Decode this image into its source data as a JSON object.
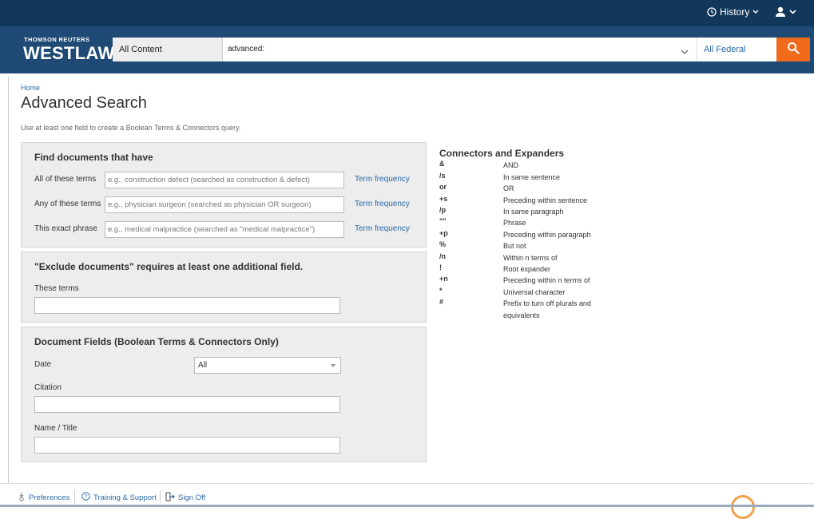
{
  "topbar": {
    "history_label": "History",
    "icons": [
      "clock-icon",
      "chevron-down-icon",
      "user-icon"
    ]
  },
  "header": {
    "brand_small": "THOMSON REUTERS",
    "brand_big": "WESTLAW",
    "content_select": "All Content",
    "search_value": "advanced:",
    "jurisdiction": "All Federal",
    "search_icon": "search-icon"
  },
  "breadcrumb": "Home",
  "page_title": "Advanced Search",
  "instructions": "Use at least one field to create a Boolean Terms & Connectors query.",
  "find_panel": {
    "title": "Find documents that have",
    "term_frequency": "Term frequency",
    "fields": [
      {
        "label": "All of these terms",
        "placeholder": "e.g., construction defect (searched as construction & defect)"
      },
      {
        "label": "Any of these terms",
        "placeholder": "e.g., physician surgeon (searched as physician OR surgeon)"
      },
      {
        "label": "This exact phrase",
        "placeholder": "e.g., medical malpractice (searched as \"medical malpractice\")"
      }
    ]
  },
  "exclude_panel": {
    "title": "\"Exclude documents\" requires at least one additional field.",
    "label": "These terms"
  },
  "fields_panel": {
    "title": "Document Fields (Boolean Terms & Connectors Only)",
    "date_label": "Date",
    "date_value": "All",
    "citation_label": "Citation",
    "name_label": "Name / Title"
  },
  "connectors": {
    "title": "Connectors and Expanders",
    "rows": [
      {
        "symbol": "&",
        "desc": "AND"
      },
      {
        "symbol": "/s",
        "desc": "In same sentence"
      },
      {
        "symbol": "or",
        "desc": "OR"
      },
      {
        "symbol": "+s",
        "desc": "Preceding within sentence"
      },
      {
        "symbol": "/p",
        "desc": "In same paragraph"
      },
      {
        "symbol": "\"\"",
        "desc": "Phrase"
      },
      {
        "symbol": "+p",
        "desc": "Preceding within paragraph"
      },
      {
        "symbol": "%",
        "desc": "But not"
      },
      {
        "symbol": "/n",
        "desc": "Within n terms of"
      },
      {
        "symbol": "!",
        "desc": "Root expander"
      },
      {
        "symbol": "+n",
        "desc": "Preceding within n terms of"
      },
      {
        "symbol": "*",
        "desc": "Universal character"
      },
      {
        "symbol": "#",
        "desc": "Prefix to turn off plurals and equivalents"
      }
    ]
  },
  "footer": {
    "preferences": "Preferences",
    "training": "Training & Support",
    "sign_off": "Sign Off"
  },
  "colors": {
    "topbar": "#11375a",
    "header": "#1e4a75",
    "accent": "#f26b1d",
    "link": "#2a6aa8"
  }
}
